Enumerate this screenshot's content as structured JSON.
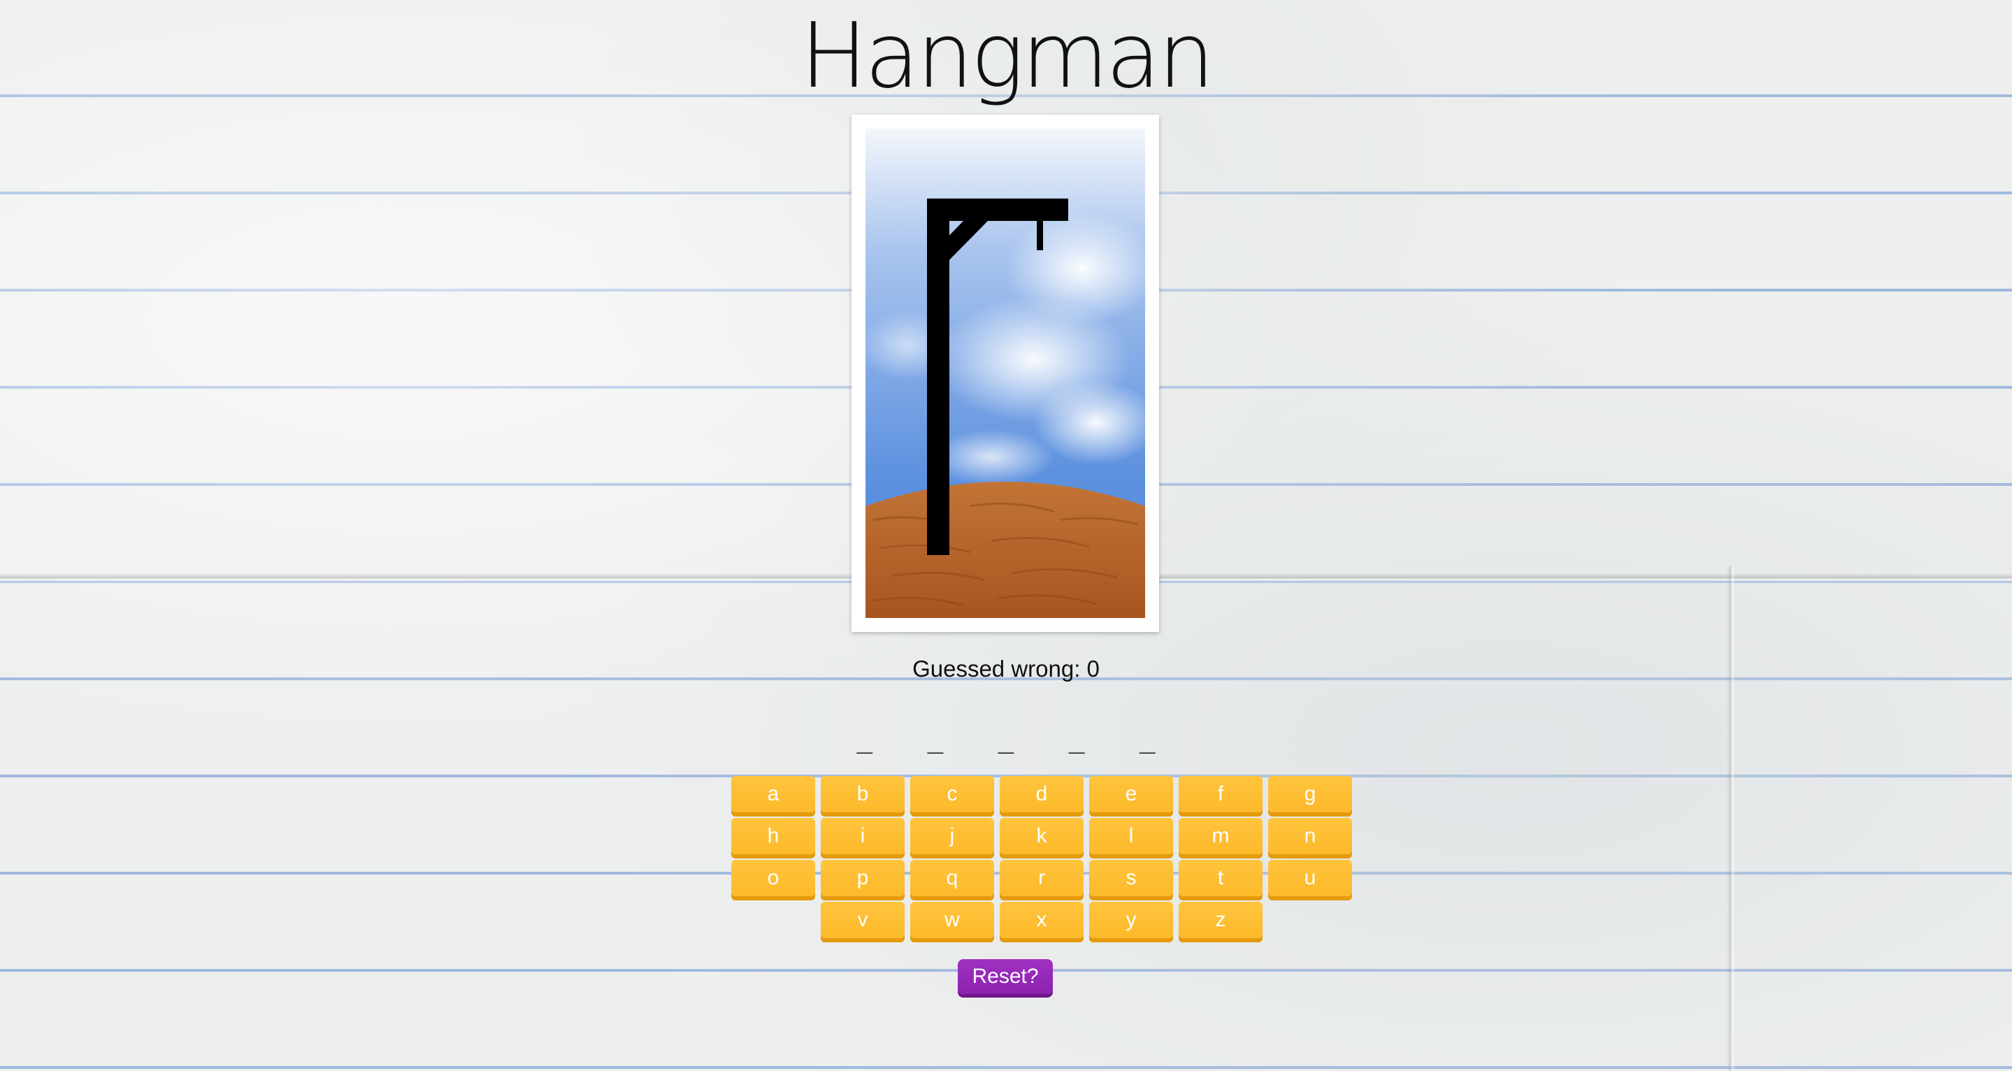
{
  "title": "Hangman",
  "status": {
    "wrong_label": "Guessed wrong: 0",
    "wrong_count": 0
  },
  "word": {
    "blanks": [
      "_",
      "_",
      "_",
      "_",
      "_"
    ]
  },
  "keyboard": {
    "rows": [
      [
        "a",
        "b",
        "c",
        "d",
        "e",
        "f",
        "g"
      ],
      [
        "h",
        "i",
        "j",
        "k",
        "l",
        "m",
        "n"
      ],
      [
        "o",
        "p",
        "q",
        "r",
        "s",
        "t",
        "u"
      ],
      [
        "v",
        "w",
        "x",
        "y",
        "z"
      ]
    ]
  },
  "reset_label": "Reset?",
  "colors": {
    "key": "#fdb92b",
    "key_shadow": "#e59a0b",
    "reset": "#8c22ae",
    "sky": "#5a8fdf",
    "ground": "#b9652a"
  }
}
